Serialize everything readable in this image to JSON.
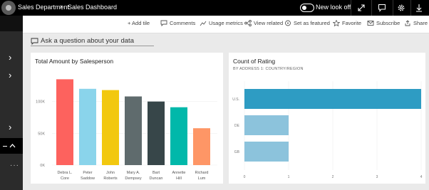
{
  "header": {
    "breadcrumb_1": "Sales Department",
    "breadcrumb_2": "Sales Dashboard",
    "new_look_label": "New look off",
    "background": "#000000"
  },
  "toolbar": {
    "items": [
      {
        "label": "+ Add tile",
        "icon": "plus-icon"
      },
      {
        "label": "Comments",
        "icon": "comment-icon"
      },
      {
        "label": "Usage metrics",
        "icon": "chart-icon"
      },
      {
        "label": "View related",
        "icon": "related-icon"
      },
      {
        "label": "Set as featured",
        "icon": "featured-icon"
      },
      {
        "label": "Favorite",
        "icon": "star-icon"
      },
      {
        "label": "Subscribe",
        "icon": "mail-icon"
      },
      {
        "label": "Share",
        "icon": "share-icon"
      }
    ]
  },
  "qa": {
    "placeholder": "Ask a question about your data"
  },
  "chart_data": [
    {
      "type": "bar",
      "title": "Total Amount by Salesperson",
      "categories": [
        "Debra L. Core",
        "Peter Saddow",
        "John Roberts",
        "Mary A. Dempsey",
        "Bart Duncan",
        "Annette Hill",
        "Richard Lum"
      ],
      "category_lines": [
        [
          "Debra L.",
          "Core"
        ],
        [
          "Peter",
          "Saddow"
        ],
        [
          "John",
          "Roberts"
        ],
        [
          "Mary A.",
          "Dempsey"
        ],
        [
          "Bart",
          "Duncan"
        ],
        [
          "Annette",
          "Hill"
        ],
        [
          "Richard",
          "Lum"
        ]
      ],
      "values": [
        135000,
        120000,
        118000,
        108000,
        100000,
        91000,
        58000
      ],
      "colors": [
        "#fd625e",
        "#8ad4eb",
        "#f2c80f",
        "#5f6b6d",
        "#374649",
        "#01b8aa",
        "#fe9666"
      ],
      "yticks": [
        0,
        50000,
        100000
      ],
      "ytick_labels": [
        "0K",
        "50K",
        "100K"
      ],
      "ylim": [
        0,
        150000
      ],
      "xlabel": "",
      "ylabel": ""
    },
    {
      "type": "bar",
      "orientation": "horizontal",
      "title": "Count of Rating",
      "subtitle": "BY ADDRESS 1: COUNTRY/REGION",
      "categories": [
        "U.S.",
        "DE",
        "GB"
      ],
      "values": [
        4,
        1,
        1
      ],
      "colors": [
        "#2e9cc3",
        "#8cc3dc",
        "#8cc3dc"
      ],
      "xticks": [
        0,
        1,
        2,
        3,
        4
      ],
      "xlim": [
        0,
        4
      ],
      "xlabel": "",
      "ylabel": ""
    }
  ]
}
